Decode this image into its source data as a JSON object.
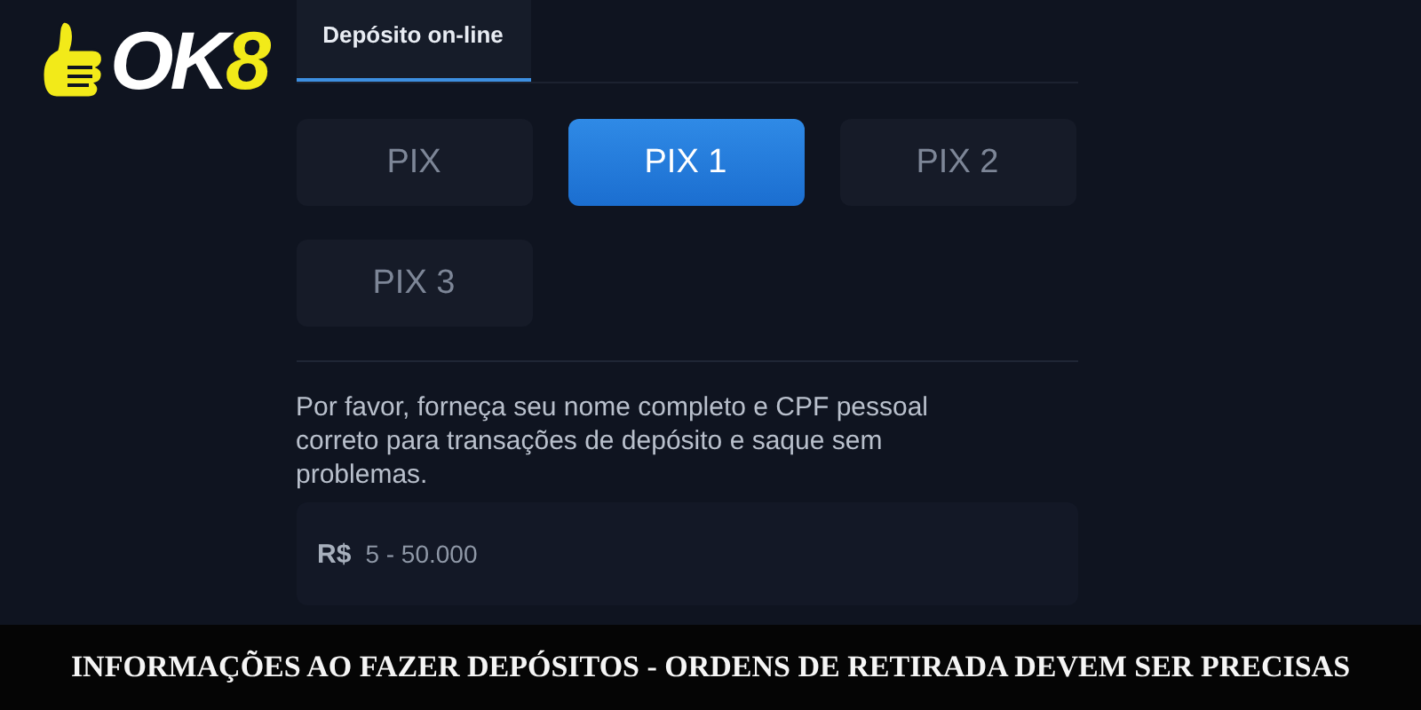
{
  "logo": {
    "text_main": "OK",
    "text_accent": "8"
  },
  "tabs": [
    {
      "label": "Depósito on-line",
      "selected": true
    }
  ],
  "methods": [
    {
      "label": "PIX",
      "selected": false
    },
    {
      "label": "PIX 1",
      "selected": true
    },
    {
      "label": "PIX 2",
      "selected": false
    },
    {
      "label": "PIX 3",
      "selected": false
    }
  ],
  "notice": "Por favor, forneça seu nome completo e CPF pessoal correto para transações de depósito e saque sem problemas.",
  "amount_field": {
    "prefix": "R$",
    "placeholder": "5 - 50.000"
  },
  "caption": "INFORMAÇÕES AO FAZER DEPÓSITOS - ORDENS DE RETIRADA DEVEM SER PRECISAS"
}
